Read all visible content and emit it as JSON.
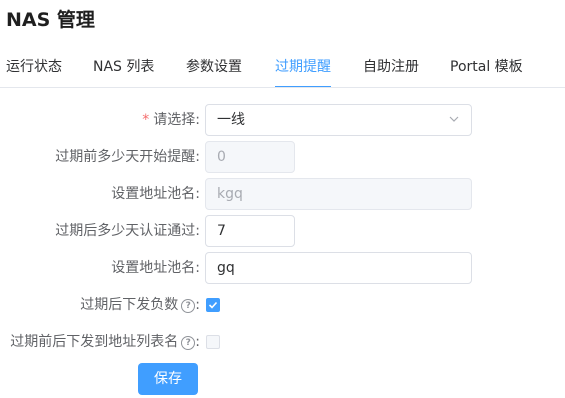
{
  "page": {
    "title": "NAS 管理"
  },
  "tabs": [
    {
      "label": "运行状态",
      "active": false
    },
    {
      "label": "NAS 列表",
      "active": false
    },
    {
      "label": "参数设置",
      "active": false
    },
    {
      "label": "过期提醒",
      "active": true
    },
    {
      "label": "自助注册",
      "active": false
    },
    {
      "label": "Portal 模板",
      "active": false
    }
  ],
  "form": {
    "select": {
      "required_mark": "*",
      "label": "请选择:",
      "value": "一线"
    },
    "remind_days": {
      "label": "过期前多少天开始提醒:",
      "value": "0",
      "disabled": true
    },
    "pool_before": {
      "label": "设置地址池名:",
      "value": "kgq",
      "disabled": true
    },
    "auth_days": {
      "label": "过期后多少天认证通过:",
      "value": "7"
    },
    "pool_after": {
      "label": "设置地址池名:",
      "value": "gq"
    },
    "send_negative": {
      "label": "过期后下发负数",
      "help": "?",
      "suffix": ":",
      "checked": true
    },
    "send_address_list": {
      "label": "过期前后下发到地址列表名",
      "help": "?",
      "suffix": ":",
      "checked": false,
      "disabled": true
    }
  },
  "actions": {
    "save_label": "保存"
  },
  "colors": {
    "primary": "#409eff",
    "danger": "#f56c6c",
    "border": "#dcdfe6",
    "disabled_bg": "#f5f7fa"
  }
}
